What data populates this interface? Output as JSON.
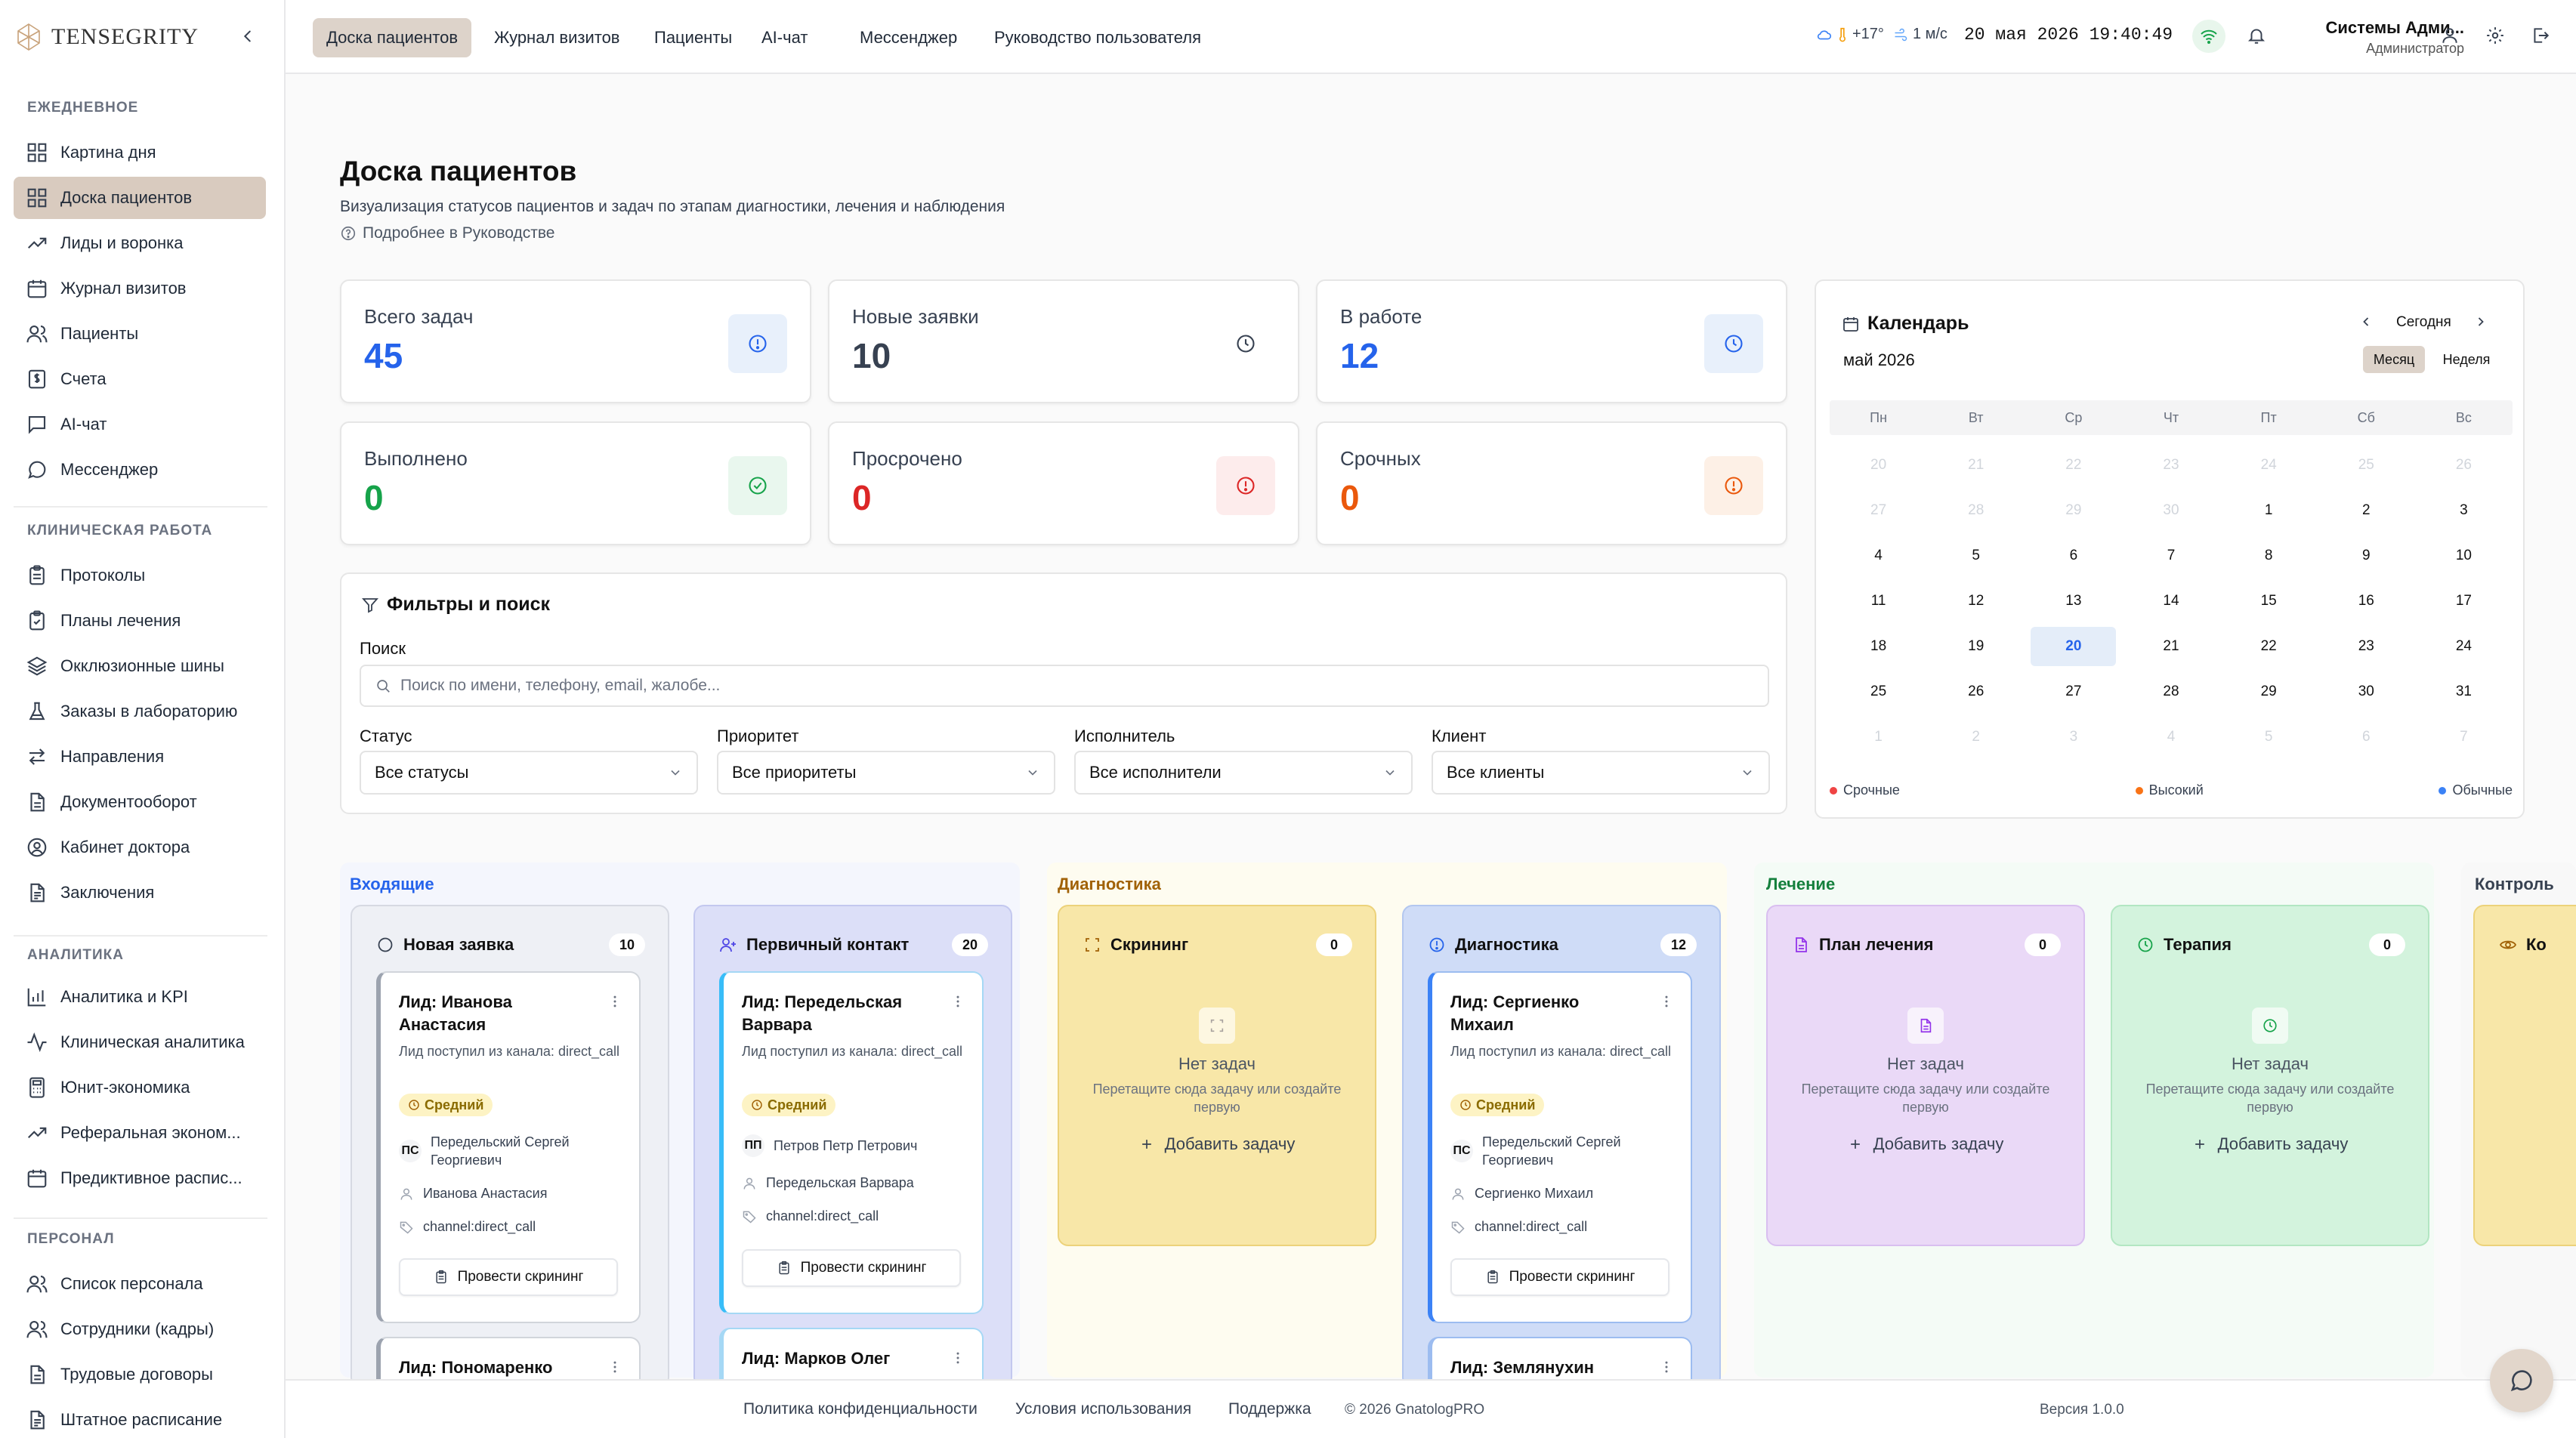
{
  "brand": "Tensegrity",
  "colors": {
    "accent": "#d9cbbf",
    "blue": "#2563eb",
    "green": "#16a34a",
    "red": "#dc2626",
    "orange": "#ea580c"
  },
  "sidebar": {
    "sections": [
      {
        "title": "ЕЖЕДНЕВНОЕ",
        "items": [
          {
            "label": "Картина дня",
            "icon": "grid-icon"
          },
          {
            "label": "Доска пациентов",
            "icon": "grid-icon",
            "active": true
          },
          {
            "label": "Лиды и воронка",
            "icon": "trending-up-icon"
          },
          {
            "label": "Журнал визитов",
            "icon": "calendar-icon"
          },
          {
            "label": "Пациенты",
            "icon": "users-icon"
          },
          {
            "label": "Счета",
            "icon": "dollar-icon"
          },
          {
            "label": "AI-чат",
            "icon": "chat-square-icon"
          },
          {
            "label": "Мессенджер",
            "icon": "chat-bubble-icon"
          }
        ]
      },
      {
        "title": "КЛИНИЧЕСКАЯ РАБОТА",
        "items": [
          {
            "label": "Протоколы",
            "icon": "clipboard-icon"
          },
          {
            "label": "Планы лечения",
            "icon": "clipboard-check-icon"
          },
          {
            "label": "Окклюзионные шины",
            "icon": "layers-icon"
          },
          {
            "label": "Заказы в лабораторию",
            "icon": "flask-icon"
          },
          {
            "label": "Направления",
            "icon": "arrows-icon"
          },
          {
            "label": "Документооборот",
            "icon": "file-icon"
          },
          {
            "label": "Кабинет доктора",
            "icon": "user-circle-icon"
          },
          {
            "label": "Заключения",
            "icon": "file-text-icon"
          }
        ]
      },
      {
        "title": "АНАЛИТИКА",
        "items": [
          {
            "label": "Аналитика и KPI",
            "icon": "bar-chart-icon"
          },
          {
            "label": "Клиническая аналитика",
            "icon": "activity-icon"
          },
          {
            "label": "Юнит-экономика",
            "icon": "calculator-icon"
          },
          {
            "label": "Реферальная эконом...",
            "icon": "trending-up-icon"
          },
          {
            "label": "Предиктивное распис...",
            "icon": "calendar-icon"
          }
        ]
      },
      {
        "title": "ПЕРСОНАЛ",
        "items": [
          {
            "label": "Список персонала",
            "icon": "users-icon"
          },
          {
            "label": "Сотрудники (кадры)",
            "icon": "users-icon"
          },
          {
            "label": "Трудовые договоры",
            "icon": "file-icon"
          },
          {
            "label": "Штатное расписание",
            "icon": "file-text-icon"
          }
        ]
      }
    ]
  },
  "topbar": {
    "nav": [
      {
        "label": "Доска пациентов",
        "active": true
      },
      {
        "label": "Журнал визитов"
      },
      {
        "label": "Пациенты"
      },
      {
        "label": "AI-чат"
      },
      {
        "label": "Мессенджер"
      },
      {
        "label": "Руководство пользователя"
      }
    ],
    "weather": {
      "temp": "+17°",
      "wind": "1 м/с"
    },
    "datetime": "20 мая 2026 19:40:49",
    "user": {
      "name": "Системы Адми...",
      "role": "Администратор"
    }
  },
  "page": {
    "title": "Доска пациентов",
    "subtitle": "Визуализация статусов пациентов и задач по этапам диагностики, лечения и наблюдения",
    "guide_link": "Подробнее в Руководстве"
  },
  "stats": [
    {
      "label": "Всего задач",
      "value": "45",
      "color": "#2563eb",
      "icon": "alert-circle-icon"
    },
    {
      "label": "Новые заявки",
      "value": "10",
      "color": "#374151",
      "icon": "clock-icon"
    },
    {
      "label": "В работе",
      "value": "12",
      "color": "#2563eb",
      "icon": "clock-icon"
    },
    {
      "label": "Выполнено",
      "value": "0",
      "color": "#16a34a",
      "icon": "check-circle-icon"
    },
    {
      "label": "Просрочено",
      "value": "0",
      "color": "#dc2626",
      "icon": "alert-circle-icon"
    },
    {
      "label": "Срочных",
      "value": "0",
      "color": "#ea580c",
      "icon": "alert-circle-icon"
    }
  ],
  "filters": {
    "title": "Фильтры и поиск",
    "search_label": "Поиск",
    "search_placeholder": "Поиск по имени, телефону, email, жалобе...",
    "selects": [
      {
        "label": "Статус",
        "value": "Все статусы"
      },
      {
        "label": "Приоритет",
        "value": "Все приоритеты"
      },
      {
        "label": "Исполнитель",
        "value": "Все исполнители"
      },
      {
        "label": "Клиент",
        "value": "Все клиенты"
      }
    ]
  },
  "calendar": {
    "title": "Календарь",
    "month": "май 2026",
    "today_btn": "Сегодня",
    "view_month": "Месяц",
    "view_week": "Неделя",
    "weekdays": [
      "Пн",
      "Вт",
      "Ср",
      "Чт",
      "Пт",
      "Сб",
      "Вс"
    ],
    "days": [
      {
        "d": "20",
        "m": true
      },
      {
        "d": "21",
        "m": true
      },
      {
        "d": "22",
        "m": true
      },
      {
        "d": "23",
        "m": true
      },
      {
        "d": "24",
        "m": true
      },
      {
        "d": "25",
        "m": true
      },
      {
        "d": "26",
        "m": true
      },
      {
        "d": "27",
        "m": true
      },
      {
        "d": "28",
        "m": true
      },
      {
        "d": "29",
        "m": true
      },
      {
        "d": "30",
        "m": true
      },
      {
        "d": "1"
      },
      {
        "d": "2"
      },
      {
        "d": "3"
      },
      {
        "d": "4"
      },
      {
        "d": "5"
      },
      {
        "d": "6"
      },
      {
        "d": "7"
      },
      {
        "d": "8"
      },
      {
        "d": "9"
      },
      {
        "d": "10"
      },
      {
        "d": "11"
      },
      {
        "d": "12"
      },
      {
        "d": "13"
      },
      {
        "d": "14"
      },
      {
        "d": "15"
      },
      {
        "d": "16"
      },
      {
        "d": "17"
      },
      {
        "d": "18"
      },
      {
        "d": "19"
      },
      {
        "d": "20",
        "t": true
      },
      {
        "d": "21"
      },
      {
        "d": "22"
      },
      {
        "d": "23"
      },
      {
        "d": "24"
      },
      {
        "d": "25"
      },
      {
        "d": "26"
      },
      {
        "d": "27"
      },
      {
        "d": "28"
      },
      {
        "d": "29"
      },
      {
        "d": "30"
      },
      {
        "d": "31"
      },
      {
        "d": "1",
        "m": true
      },
      {
        "d": "2",
        "m": true
      },
      {
        "d": "3",
        "m": true
      },
      {
        "d": "4",
        "m": true
      },
      {
        "d": "5",
        "m": true
      },
      {
        "d": "6",
        "m": true
      },
      {
        "d": "7",
        "m": true
      }
    ],
    "legend": [
      {
        "label": "Срочные",
        "color": "#ef4444"
      },
      {
        "label": "Высокий",
        "color": "#f97316"
      },
      {
        "label": "Обычные",
        "color": "#3b82f6"
      }
    ]
  },
  "board": {
    "groups": [
      "Входящие",
      "Диагностика",
      "Лечение",
      "Контроль"
    ],
    "columns": [
      {
        "title": "Новая заявка",
        "count": "10",
        "icon": "circle-icon"
      },
      {
        "title": "Первичный контакт",
        "count": "20",
        "icon": "user-plus-icon"
      },
      {
        "title": "Скрининг",
        "count": "0",
        "icon": "scan-icon",
        "empty": true
      },
      {
        "title": "Диагностика",
        "count": "12",
        "icon": "alert-circle-icon"
      },
      {
        "title": "План лечения",
        "count": "0",
        "icon": "file-icon",
        "empty": true
      },
      {
        "title": "Терапия",
        "count": "0",
        "icon": "clock-icon",
        "empty": true
      },
      {
        "title": "Ко",
        "icon": "eye-icon"
      }
    ],
    "empty_text": "Нет задач",
    "empty_hint": "Перетащите сюда задачу или создайте первую",
    "add_task": "Добавить задачу",
    "cards": [
      {
        "title": "Лид: Иванова Анастасия",
        "desc": "Лид поступил из канала: direct_call",
        "priority": "Средний",
        "assignee_initials": "ПС",
        "assignee": "Передельский Сергей Георгиевич",
        "patient": "Иванова Анастасия",
        "tag": "channel:direct_call",
        "action": "Провести скрининг"
      },
      {
        "title": "Лид: Пономаренко"
      },
      {
        "title": "Лид: Передельская Варвара",
        "desc": "Лид поступил из канала: direct_call",
        "priority": "Средний",
        "assignee_initials": "ПП",
        "assignee": "Петров Петр Петрович",
        "patient": "Передельская Варвара",
        "tag": "channel:direct_call",
        "action": "Провести скрининг"
      },
      {
        "title": "Лид: Марков Олег"
      },
      {
        "title": "Лид: Сергиенко Михаил",
        "desc": "Лид поступил из канала: direct_call",
        "priority": "Средний",
        "assignee_initials": "ПС",
        "assignee": "Передельский Сергей Георгиевич",
        "patient": "Сергиенко Михаил",
        "tag": "channel:direct_call",
        "action": "Провести скрининг"
      },
      {
        "title": "Лид: Землянухин"
      }
    ]
  },
  "footer": {
    "links": [
      "Политика конфиденциальности",
      "Условия использования",
      "Поддержка"
    ],
    "copyright": "© 2026 GnatologPRO",
    "version": "Версия 1.0.0"
  }
}
